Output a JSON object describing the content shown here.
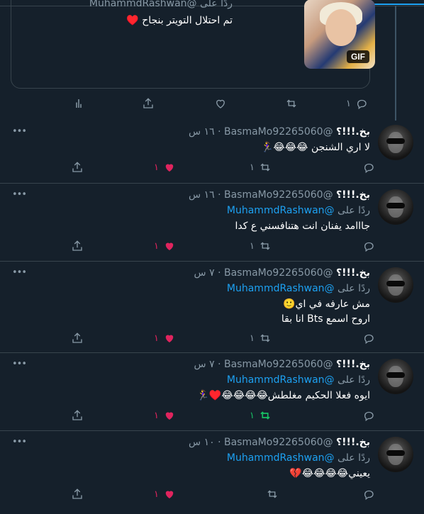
{
  "quote": {
    "reply_prefix": "ردًا على",
    "reply_handle": "@MuhammdRashwan",
    "text": "تم احتلال التويتر بنجاح ♥️",
    "gif_badge": "GIF"
  },
  "quote_actions": {
    "reply_count": "١"
  },
  "tweets": [
    {
      "name": "بخ.!!!؟",
      "handle": "@BasmaMo92265060",
      "time": "١٦ س",
      "reply_prefix": "",
      "reply_handle": "",
      "text": "لا اري الشنجن 😂😂😂🏃‍♀️",
      "reply_count": "",
      "retweet_count": "١",
      "like_count": "١",
      "retweeted": false
    },
    {
      "name": "بخ.!!!؟",
      "handle": "@BasmaMo92265060",
      "time": "١٦ س",
      "reply_prefix": "ردًا على",
      "reply_handle": "@MuhammdRashwan",
      "text": "جااامد يفنان انت هتنافسني ع كدا",
      "reply_count": "",
      "retweet_count": "١",
      "like_count": "١",
      "retweeted": false
    },
    {
      "name": "بخ.!!!؟",
      "handle": "@BasmaMo92265060",
      "time": "٧ س",
      "reply_prefix": "ردًا على",
      "reply_handle": "@MuhammdRashwan",
      "text": "مش عارفه في اي🙂\nاروح اسمع Bts انا بقا",
      "reply_count": "",
      "retweet_count": "١",
      "like_count": "١",
      "retweeted": false
    },
    {
      "name": "بخ.!!!؟",
      "handle": "@BasmaMo92265060",
      "time": "٧ س",
      "reply_prefix": "ردًا على",
      "reply_handle": "@MuhammdRashwan",
      "text": "ايوه فعلا الحكيم مغلطش😂😂😂😂♥️🏃‍♀️",
      "reply_count": "",
      "retweet_count": "١",
      "like_count": "١",
      "retweeted": true
    },
    {
      "name": "بخ.!!!؟",
      "handle": "@BasmaMo92265060",
      "time": "١٠ س",
      "reply_prefix": "ردًا على",
      "reply_handle": "@MuhammdRashwan",
      "text": "يعيني😂😂😂😂💔",
      "reply_count": "",
      "retweet_count": "",
      "like_count": "١",
      "retweeted": false
    }
  ],
  "colors": {
    "background": "#15202b",
    "like": "#e0245e",
    "retweet_active": "#17bf63",
    "link": "#1da1f2",
    "muted": "#8899a6"
  },
  "icons": [
    "reply-icon",
    "retweet-icon",
    "like-icon",
    "share-icon",
    "analytics-icon",
    "more-icon"
  ]
}
